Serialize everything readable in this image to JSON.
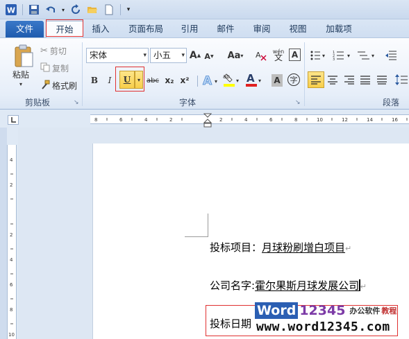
{
  "titlebar": {
    "app_icon": "word-app-icon",
    "icons": [
      "save-icon",
      "undo-icon",
      "redo-icon",
      "open-folder-icon",
      "new-doc-icon",
      "customize-qat-icon"
    ]
  },
  "tabs": [
    "文件",
    "开始",
    "插入",
    "页面布局",
    "引用",
    "邮件",
    "审阅",
    "视图",
    "加载项"
  ],
  "clipboard": {
    "paste_label": "粘贴",
    "cut_label": "剪切",
    "copy_label": "复制",
    "format_painter_label": "格式刷",
    "group_label": "剪贴板"
  },
  "font": {
    "font_name": "宋体",
    "font_size": "小五",
    "bold": "B",
    "italic": "I",
    "underline": "U",
    "strike": "abc",
    "subscript": "x₂",
    "superscript": "x²",
    "grow": "A",
    "shrink": "A",
    "change_case": "Aa",
    "phonetic": "wén",
    "group_label": "字体"
  },
  "paragraph": {
    "group_label": "段落"
  },
  "document": {
    "line1_label": "投标项目：",
    "line1_value": "月球粉刷增白项目",
    "line2_label": "公司名字:",
    "line2_value": "霍尔果斯月球发展公司",
    "line3_label": "投标日期",
    "pilcrow": "↵"
  },
  "watermark": {
    "word": "Word",
    "num": "12345",
    "cn1": "办公软件",
    "cn2": "教程",
    "url": "www.word12345.com"
  },
  "colors": {
    "accent_red": "#e03030",
    "file_tab": "#2a66b8"
  }
}
